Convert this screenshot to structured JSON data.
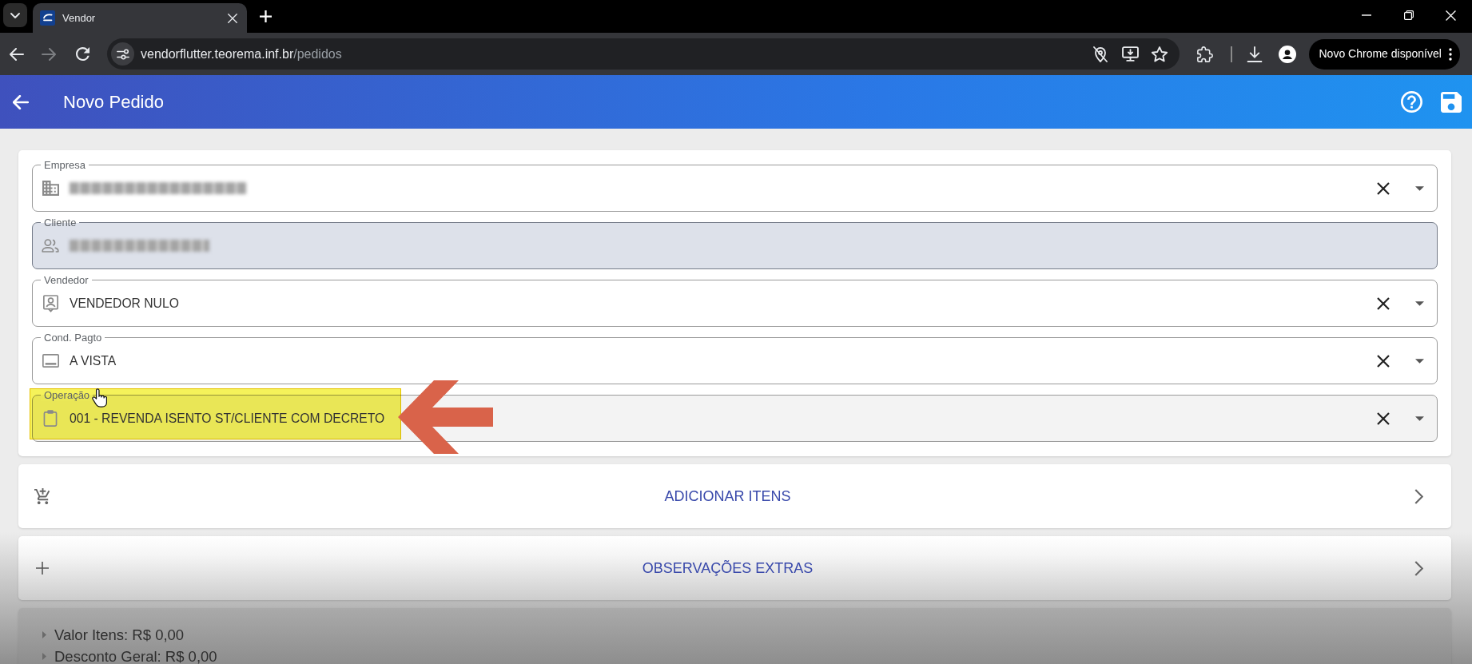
{
  "browser": {
    "tabs": [
      {
        "title": "Vendor",
        "selected": true
      }
    ],
    "back_enabled": true,
    "forward_enabled": false,
    "url": "vendorflutter.teorema.inf.br/pedidos",
    "update_button": "Novo Chrome disponível"
  },
  "app_bar": {
    "title": "Novo Pedido"
  },
  "form": {
    "fields": [
      {
        "label": "Empresa",
        "blurred": true,
        "disabled": false,
        "hovered": false,
        "highlighted": false
      },
      {
        "label": "Cliente",
        "blurred": true,
        "disabled": true,
        "hovered": false,
        "highlighted": false
      },
      {
        "label": "Vendedor",
        "value": "VENDEDOR NULO",
        "blurred": false,
        "disabled": false,
        "hovered": false,
        "highlighted": false
      },
      {
        "label": "Cond. Pagto",
        "value": "A VISTA",
        "blurred": false,
        "disabled": false,
        "hovered": false,
        "highlighted": false
      },
      {
        "label": "Operação",
        "value": "001 - REVENDA ISENTO ST/CLIENTE COM DECRETO",
        "blurred": false,
        "disabled": false,
        "hovered": true,
        "highlighted": true
      }
    ]
  },
  "actions": [
    {
      "label": "ADICIONAR ITENS"
    },
    {
      "label": "OBSERVAÇÕES EXTRAS"
    }
  ],
  "totals": [
    {
      "label": "Valor Itens: R$ 0,00",
      "expanded": false
    },
    {
      "label": "Desconto Geral: R$ 0,00",
      "expanded": false
    }
  ]
}
